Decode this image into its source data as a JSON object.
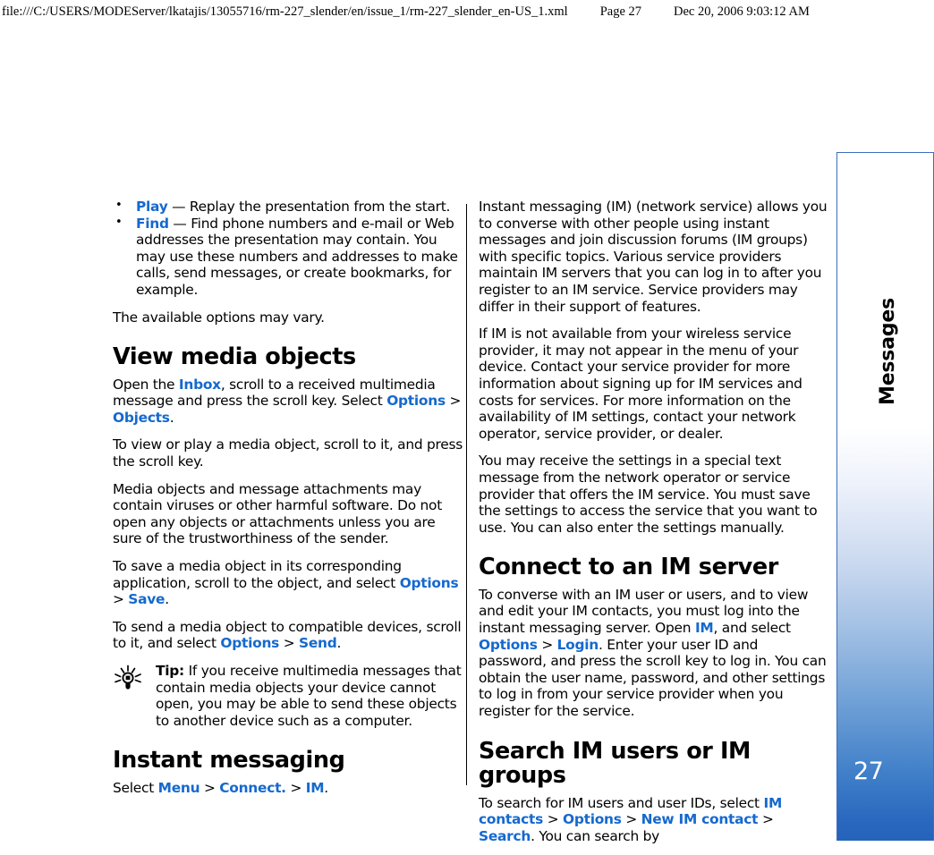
{
  "print_header": {
    "file_path": "file:///C:/USERS/MODEServer/lkatajis/13055716/rm-227_slender/en/issue_1/rm-227_slender_en-US_1.xml",
    "page_label": "Page 27",
    "timestamp": "Dec 20, 2006 9:03:12 AM"
  },
  "side_tab": {
    "chapter_label": "Messages",
    "page_number": "27",
    "accent_color": "#2563bb",
    "border_color": "#3b6fbd"
  },
  "colors": {
    "link_blue": "#1569ce",
    "text_black": "#000000",
    "page_background": "#ffffff"
  },
  "left_column": {
    "bullets": [
      {
        "term": "Play",
        "text": " — Replay the presentation from the start."
      },
      {
        "term": "Find",
        "text": " — Find phone numbers and e-mail or Web addresses the presentation may contain. You may use these numbers and addresses to make calls, send messages, or create bookmarks, for example."
      }
    ],
    "para_options_vary": "The available options may vary.",
    "heading_view_media": "View media objects",
    "para_open_inbox_1": "Open the ",
    "link_inbox": "Inbox",
    "para_open_inbox_2": ", scroll to a received multimedia message and press the scroll key. Select ",
    "link_options_1": "Options",
    "sep_gt": " > ",
    "link_objects": "Objects",
    "para_open_inbox_3": ".",
    "para_view_play": "To view or play a media object, scroll to it, and press the scroll key.",
    "para_viruses": "Media objects and message attachments may contain viruses or other harmful software. Do not open any objects or attachments unless you are sure of the trustworthiness of the sender.",
    "para_save_1": "To save a media object in its corresponding application, scroll to the object, and select ",
    "link_options_2": "Options",
    "link_save": "Save",
    "para_save_2": ".",
    "para_send_1": "To send a media object to compatible devices, scroll to it, and select ",
    "link_options_3": "Options",
    "link_send": "Send",
    "para_send_2": ".",
    "tip": {
      "icon": "lightbulb-icon",
      "label": "Tip:",
      "text": " If you receive multimedia messages that contain media objects your device cannot open, you may be able to send these objects to another device such as a computer."
    },
    "heading_instant_messaging": "Instant messaging",
    "para_select_1": "Select ",
    "link_menu": "Menu",
    "link_connect": "Connect.",
    "link_im": "IM",
    "para_select_2": "."
  },
  "right_column": {
    "para_im_intro": "Instant messaging (IM) (network service) allows you to converse with other people using instant messages and join discussion forums (IM groups) with specific topics. Various service providers maintain IM servers that you can log in to after you register to an IM service. Service providers may differ in their support of features.",
    "para_im_availability": "If IM is not available from your wireless service provider, it may not appear in the menu of your device. Contact your service provider for more information about signing up for IM services and costs for services. For more information on the availability of IM settings, contact your network operator, service provider, or dealer.",
    "para_settings_msg": "You may receive the settings in a special text message from the network operator or service provider that offers the IM service. You must save the settings to access the service that you want to use. You can also enter the settings manually.",
    "heading_connect_server": "Connect to an IM server",
    "para_connect_1": "To converse with an IM user or users, and to view and edit your IM contacts, you must log into the instant messaging server. Open ",
    "link_im": "IM",
    "para_connect_2": ", and select ",
    "link_options": "Options",
    "sep_gt": " > ",
    "link_login": "Login",
    "para_connect_3": ". Enter your user ID and password, and press the scroll key to log in. You can obtain the user name, password, and other settings to log in from your service provider when you register for the service.",
    "heading_search_users": "Search IM users or IM groups",
    "para_search_1": "To search for IM users and user IDs, select ",
    "link_im_contacts": "IM contacts",
    "link_options_2": "Options",
    "link_new_im_contact": "New IM contact",
    "link_search": "Search",
    "para_search_2": ". You can search by"
  }
}
